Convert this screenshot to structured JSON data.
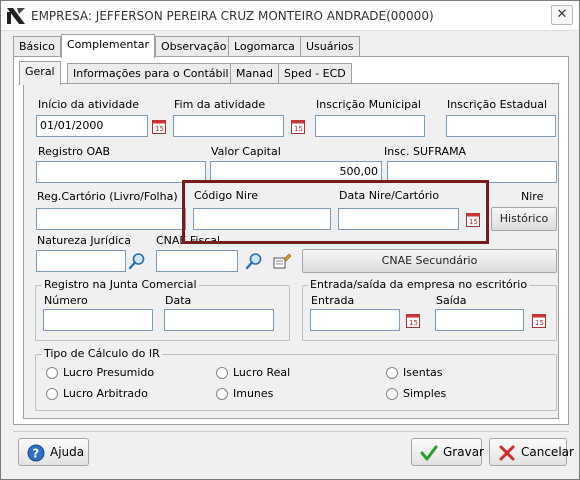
{
  "window": {
    "title": "EMPRESA: JEFFERSON PEREIRA CRUZ MONTEIRO ANDRADE(00000)",
    "close_symbol": "✕"
  },
  "tabs": [
    {
      "label": "Básico"
    },
    {
      "label": "Complementar"
    },
    {
      "label": "Observação"
    },
    {
      "label": "Logomarca"
    },
    {
      "label": "Usuários"
    }
  ],
  "subtabs": [
    {
      "label": "Geral"
    },
    {
      "label": "Informações para o Contábil"
    },
    {
      "label": "Manad"
    },
    {
      "label": "Sped - ECD"
    }
  ],
  "form": {
    "inicio_atividade": {
      "label": "Início da atividade",
      "value": "01/01/2000"
    },
    "fim_atividade": {
      "label": "Fim da atividade",
      "value": ""
    },
    "inscricao_municipal": {
      "label": "Inscrição Municipal",
      "value": ""
    },
    "inscricao_estadual": {
      "label": "Inscrição Estadual",
      "value": ""
    },
    "registro_oab": {
      "label": "Registro OAB",
      "value": ""
    },
    "valor_capital": {
      "label": "Valor Capital",
      "value": "500,00"
    },
    "insc_suframa": {
      "label": "Insc. SUFRAMA",
      "value": ""
    },
    "reg_cartorio": {
      "label": "Reg.Cartório (Livro/Folha)",
      "value": ""
    },
    "codigo_nire": {
      "label": "Código Nire",
      "value": ""
    },
    "data_nire": {
      "label": "Data Nire/Cartório",
      "value": ""
    },
    "nire_label": "Nire",
    "historico_button": "Histórico",
    "natureza_juridica": {
      "label": "Natureza Jurídica",
      "value": ""
    },
    "cnae_fiscal": {
      "label": "CNAE Fiscal",
      "value": ""
    },
    "cnae_secundario_button": "CNAE Secundário"
  },
  "registro_junta": {
    "title": "Registro na Junta Comercial",
    "numero_label": "Número",
    "data_label": "Data"
  },
  "entrada_saida": {
    "title": "Entrada/saída da empresa no escritório",
    "entrada_label": "Entrada",
    "saida_label": "Saída"
  },
  "tipo_calculo": {
    "title": "Tipo de Cálculo do IR",
    "options": [
      "Lucro Presumido",
      "Lucro Real",
      "Isentas",
      "Lucro Arbitrado",
      "Imunes",
      "Simples"
    ]
  },
  "buttons": {
    "ajuda": "Ajuda",
    "gravar": "Gravar",
    "cancelar": "Cancelar"
  },
  "colors": {
    "highlight": "#7a1b1b",
    "field_border": "#7f9db9",
    "gravar_check": "#2e9b2e",
    "cancel_x": "#d22d2d"
  }
}
